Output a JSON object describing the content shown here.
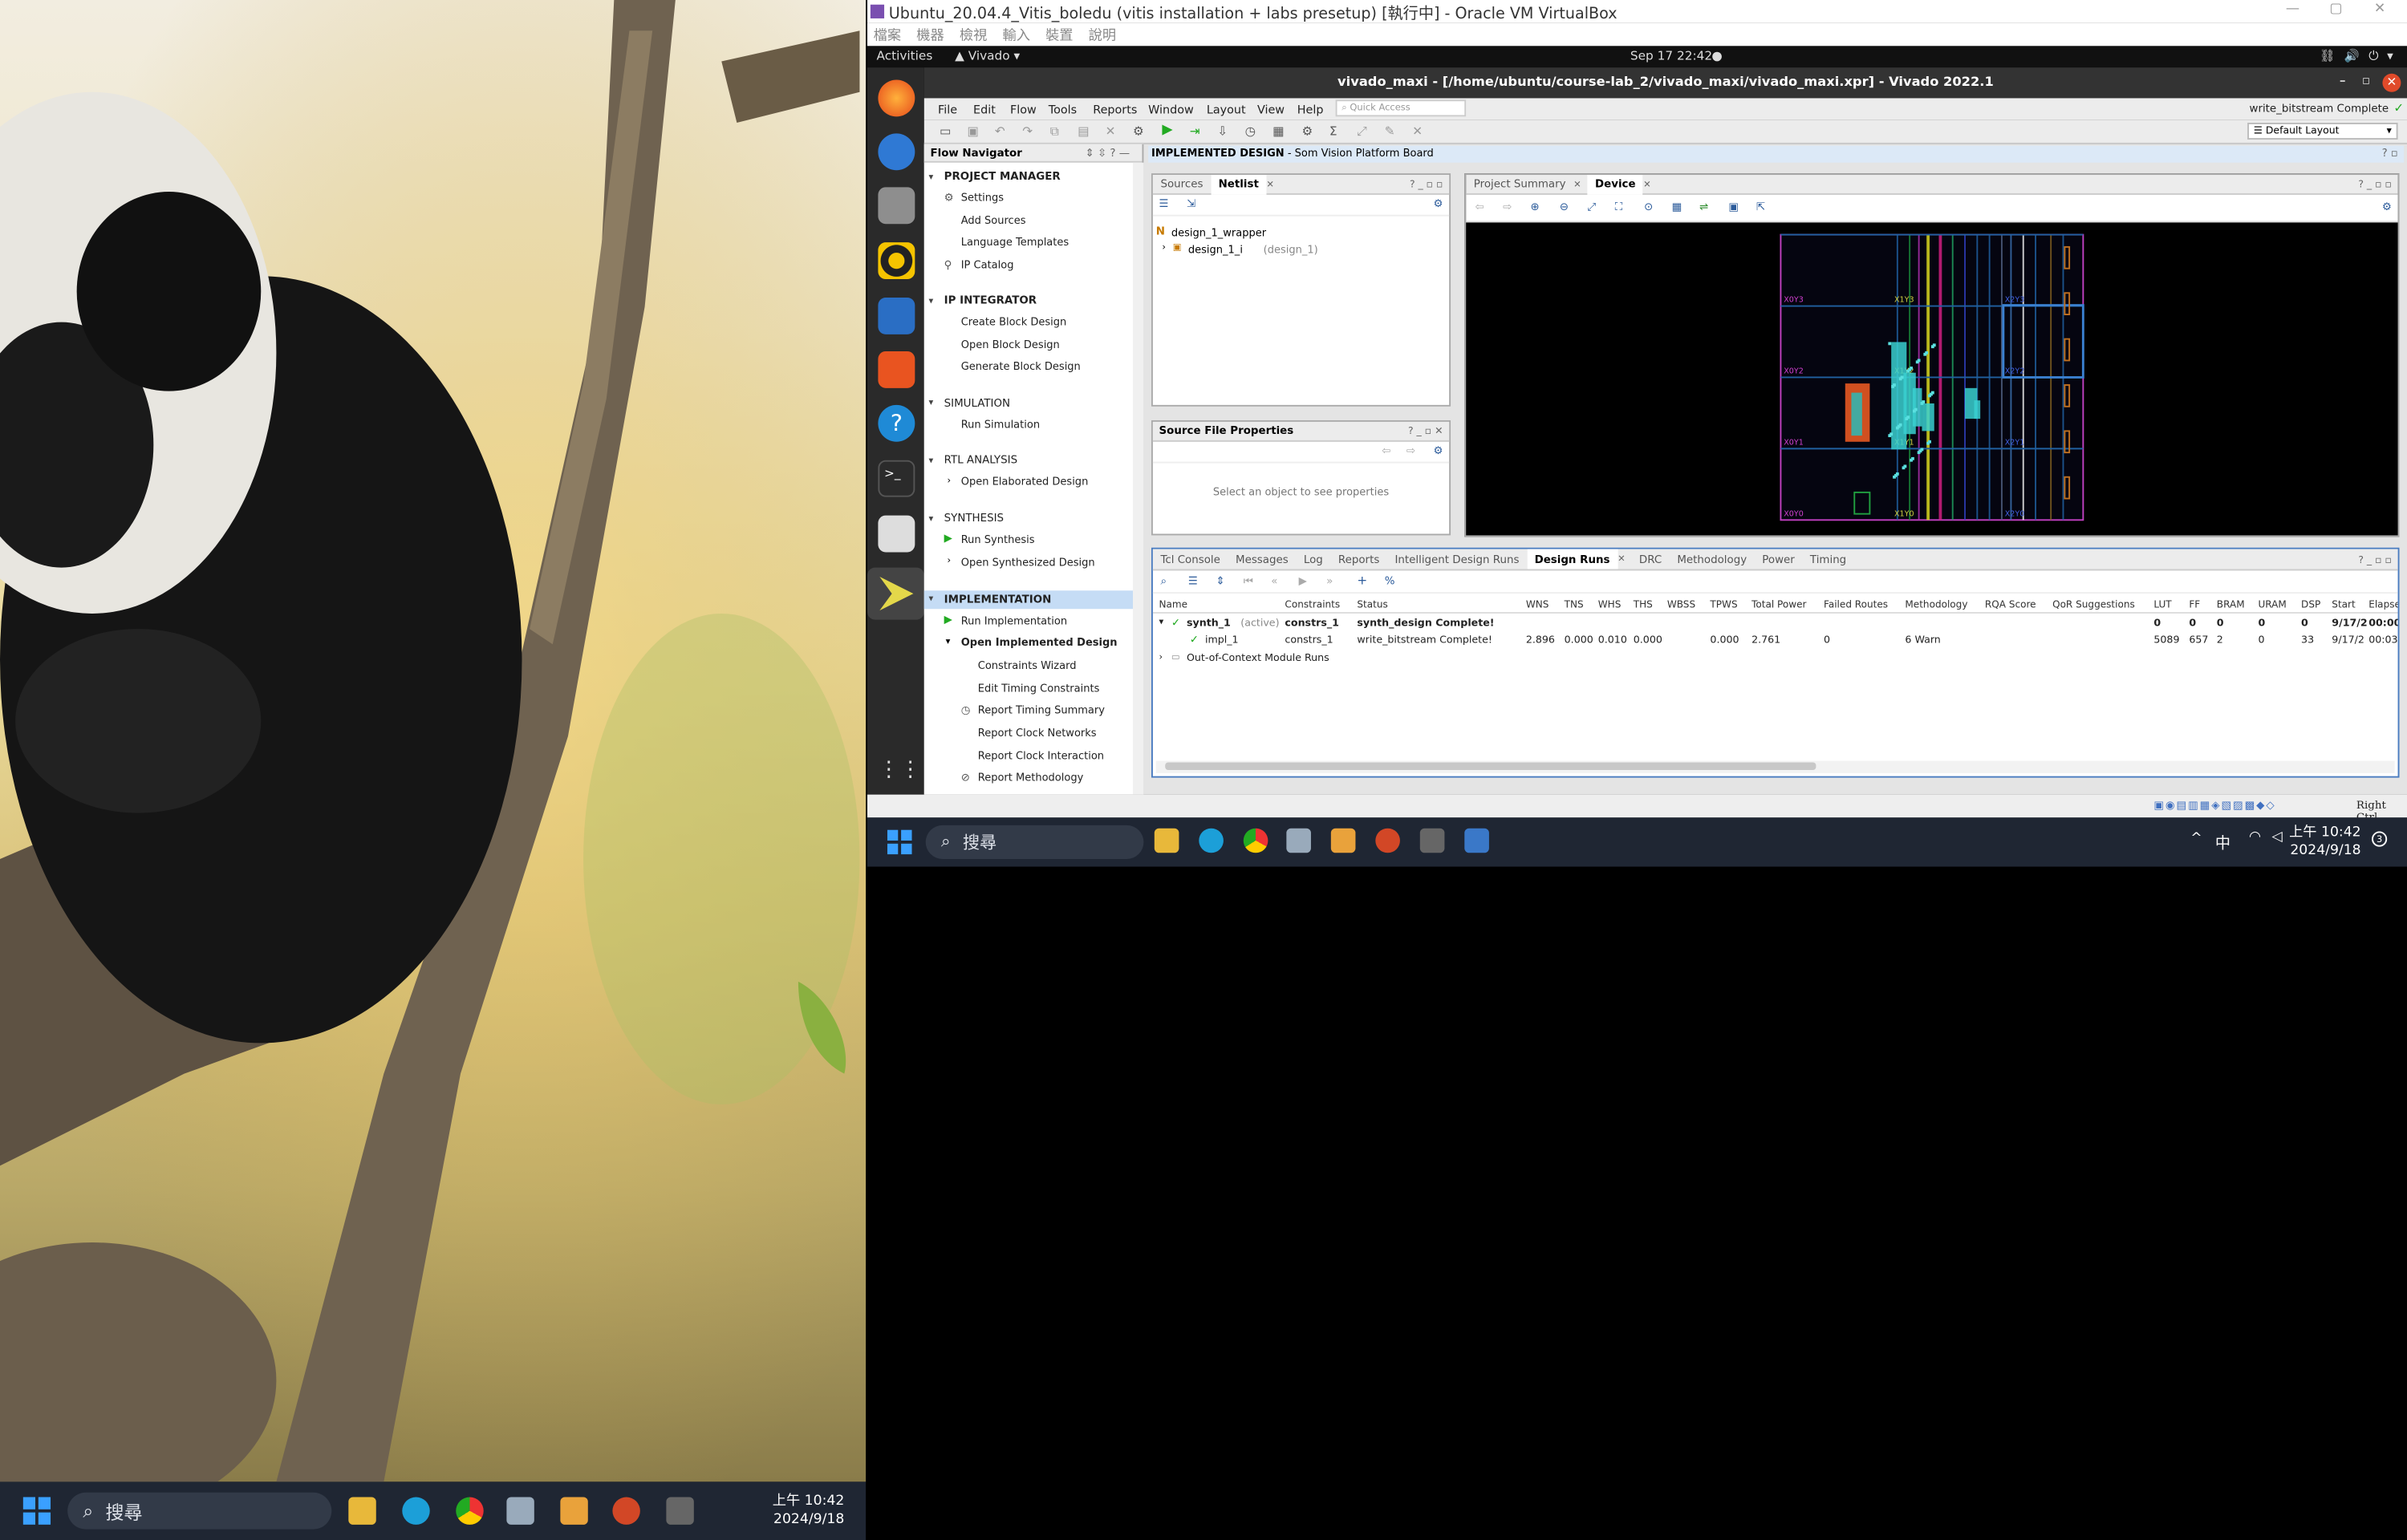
{
  "host": {
    "search_placeholder": "搜尋",
    "clock_time": "上午 10:42",
    "clock_date": "2024/9/18",
    "ime": "中",
    "notif_count": "3"
  },
  "vm": {
    "title": "Ubuntu_20.04.4_Vitis_boledu (vitis installation + labs presetup) [執行中] - Oracle VM VirtualBox",
    "menu": [
      "檔案",
      "機器",
      "檢視",
      "輸入",
      "裝置",
      "說明"
    ],
    "status_right": "Right Ctrl"
  },
  "gnome": {
    "activities": "Activities",
    "app": "Vivado",
    "datetime": "Sep 17  22:42"
  },
  "vivado": {
    "title": "vivado_maxi - [/home/ubuntu/course-lab_2/vivado_maxi/vivado_maxi.xpr] - Vivado 2022.1",
    "menu": [
      "File",
      "Edit",
      "Flow",
      "Tools",
      "Reports",
      "Window",
      "Layout",
      "View",
      "Help"
    ],
    "quick_access": "Quick Access",
    "status_msg": "write_bitstream Complete",
    "layout_select": "Default Layout",
    "banner_bold": "IMPLEMENTED DESIGN",
    "banner_rest": " - Som Vision Platform Board"
  },
  "flow_nav": {
    "title": "Flow Navigator",
    "sections": [
      {
        "label": "PROJECT MANAGER",
        "items": [
          "Settings",
          "Add Sources",
          "Language Templates",
          "IP Catalog"
        ]
      },
      {
        "label": "IP INTEGRATOR",
        "items": [
          "Create Block Design",
          "Open Block Design",
          "Generate Block Design"
        ]
      },
      {
        "label": "SIMULATION",
        "items": [
          "Run Simulation"
        ]
      },
      {
        "label": "RTL ANALYSIS",
        "items": [
          "Open Elaborated Design"
        ]
      },
      {
        "label": "SYNTHESIS",
        "items": [
          "Run Synthesis",
          "Open Synthesized Design"
        ]
      },
      {
        "label": "IMPLEMENTATION",
        "items": [
          "Run Implementation",
          "Open Implemented Design",
          "Constraints Wizard",
          "Edit Timing Constraints",
          "Report Timing Summary",
          "Report Clock Networks",
          "Report Clock Interaction",
          "Report Methodology"
        ]
      }
    ]
  },
  "netlist": {
    "tabs": [
      "Sources",
      "Netlist"
    ],
    "root": "design_1_wrapper",
    "child": "design_1_i",
    "child_type": "(design_1)"
  },
  "sfp": {
    "title": "Source File Properties",
    "placeholder": "Select an object to see properties"
  },
  "device": {
    "tabs": [
      "Project Summary",
      "Device"
    ],
    "clock_regions": [
      "X0Y3",
      "X1Y3",
      "X2Y3",
      "X0Y2",
      "X1Y2",
      "X2Y2",
      "X0Y1",
      "X1Y1",
      "X2Y1",
      "X0Y0",
      "X1Y0",
      "X2Y0"
    ]
  },
  "runs": {
    "tabs": [
      "Tcl Console",
      "Messages",
      "Log",
      "Reports",
      "Intelligent Design Runs",
      "Design Runs",
      "DRC",
      "Methodology",
      "Power",
      "Timing"
    ],
    "columns": [
      "Name",
      "Constraints",
      "Status",
      "WNS",
      "TNS",
      "WHS",
      "THS",
      "WBSS",
      "TPWS",
      "Total Power",
      "Failed Routes",
      "Methodology",
      "RQA Score",
      "QoR Suggestions",
      "LUT",
      "FF",
      "BRAM",
      "URAM",
      "DSP",
      "Start",
      "Elapsed"
    ],
    "rows": [
      {
        "name": "synth_1",
        "tag": "(active)",
        "constraints": "constrs_1",
        "status": "synth_design Complete!",
        "wns": "",
        "tns": "",
        "whs": "",
        "ths": "",
        "wbss": "",
        "tpws": "",
        "power": "",
        "failed": "",
        "meth": "",
        "lut": "0",
        "ff": "0",
        "bram": "0",
        "uram": "0",
        "dsp": "0",
        "start": "9/17/2",
        "elapsed": "00:00"
      },
      {
        "name": "impl_1",
        "tag": "",
        "constraints": "constrs_1",
        "status": "write_bitstream Complete!",
        "wns": "2.896",
        "tns": "0.000",
        "whs": "0.010",
        "ths": "0.000",
        "wbss": "",
        "tpws": "0.000",
        "power": "2.761",
        "failed": "0",
        "meth": "6 Warn",
        "lut": "5089",
        "ff": "657",
        "bram": "2",
        "uram": "0",
        "dsp": "33",
        "start": "9/17/2",
        "elapsed": "00:03"
      }
    ],
    "ooc": "Out-of-Context Module Runs"
  },
  "colors": {
    "accent": "#1a66b8",
    "selected": "#c5dcf5",
    "vivado_bar": "#333333"
  }
}
